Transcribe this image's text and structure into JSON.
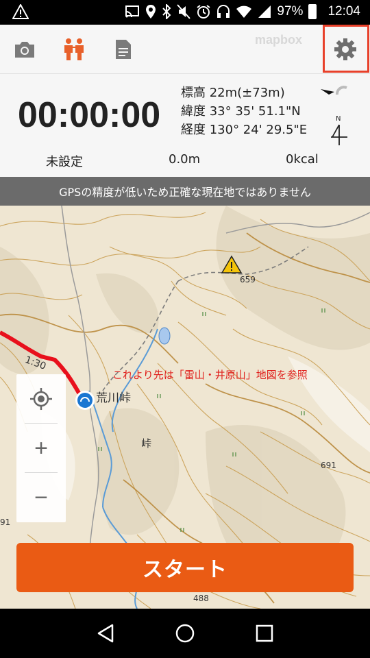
{
  "status_bar": {
    "battery": "97%",
    "time": "12:04",
    "icons": [
      "warning-icon",
      "cast-icon",
      "location-icon",
      "bluetooth-icon",
      "mute-icon",
      "alarm-icon",
      "headset-icon",
      "wifi-icon",
      "signal-icon",
      "battery-icon"
    ]
  },
  "toolbar": {
    "icons": [
      "camera-icon",
      "hikers-icon",
      "document-icon",
      "gear-icon"
    ],
    "mapbox": "mapbox",
    "accent": "#e8602a"
  },
  "record": {
    "timer": "00:00:00",
    "elevation": "標高 22m(±73m)",
    "latitude": "緯度 33° 35' 51.1\"N",
    "longitude": "経度 130° 24' 29.5\"E",
    "compass_n": "N"
  },
  "stats": {
    "destination": "未設定",
    "distance": "0.0m",
    "calories": "0kcal"
  },
  "gps_warning": "GPSの精度が低いため正確な現在地ではありません",
  "map": {
    "note": "これより先は「雷山・井原山」地図を参照",
    "pass_name": "荒川峠",
    "kanji_mark": "峠",
    "elevation_659": "659",
    "elevation_691": "691",
    "elevation_488": "488",
    "elevation_91": "91",
    "route_time": "1:30",
    "zoom_locate_icon": "locate-icon",
    "zoom_in": "+",
    "zoom_out": "−"
  },
  "start_button": "スタート",
  "nav": [
    "back-icon",
    "home-icon",
    "recents-icon"
  ]
}
